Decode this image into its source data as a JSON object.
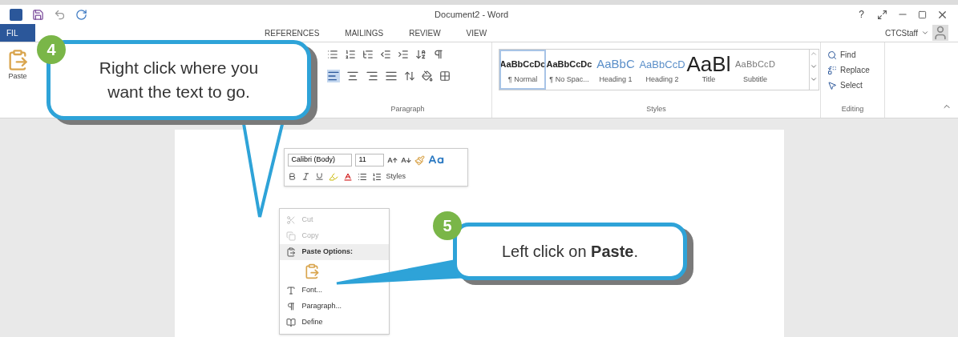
{
  "window": {
    "title": "Document2 - Word",
    "help": "?",
    "user": "CTCStaff"
  },
  "ribbon_tabs": [
    {
      "label": "FIL",
      "selected": true
    },
    {
      "label": "REFERENCES",
      "selected": false
    },
    {
      "label": "MAILINGS",
      "selected": false
    },
    {
      "label": "REVIEW",
      "selected": false
    },
    {
      "label": "VIEW",
      "selected": false
    }
  ],
  "clipboard": {
    "paste": "Paste"
  },
  "paragraph": {
    "label": "Paragraph",
    "align_buttons": [
      {
        "selected": true
      },
      {
        "selected": false
      },
      {
        "selected": false
      },
      {
        "selected": false
      }
    ]
  },
  "styles": {
    "label": "Styles",
    "items": [
      {
        "preview": "AaBbCcDc",
        "name": "¶ Normal",
        "kind": "normal",
        "selected": true
      },
      {
        "preview": "AaBbCcDc",
        "name": "¶ No Spac...",
        "kind": "nospacing",
        "selected": false
      },
      {
        "preview": "AaBbC",
        "name": "Heading 1",
        "kind": "heading1",
        "selected": false
      },
      {
        "preview": "AaBbCcD",
        "name": "Heading 2",
        "kind": "heading2",
        "selected": false
      },
      {
        "preview": "AaBl",
        "name": "Title",
        "kind": "title",
        "selected": false
      },
      {
        "preview": "AaBbCcD",
        "name": "Subtitle",
        "kind": "subtitle",
        "selected": false
      }
    ]
  },
  "editing": {
    "label": "Editing",
    "items": [
      {
        "label": "Find",
        "kind": "find"
      },
      {
        "label": "Replace",
        "kind": "replace"
      },
      {
        "label": "Select",
        "kind": "select"
      }
    ]
  },
  "mini_toolbar": {
    "font": "Calibri (Body)",
    "size": "11",
    "styles": "Styles"
  },
  "context_menu": [
    {
      "label": "Cut",
      "kind": "cut",
      "disabled": true
    },
    {
      "label": "Copy",
      "kind": "copy",
      "disabled": true
    },
    {
      "label": "Paste Options:",
      "kind": "heading",
      "disabled": false
    },
    {
      "kind": "paste-option",
      "disabled": false
    },
    {
      "label": "Font...",
      "kind": "font",
      "disabled": false
    },
    {
      "label": "Paragraph...",
      "kind": "paragraph",
      "disabled": false
    },
    {
      "label": "Define",
      "kind": "define",
      "disabled": false
    }
  ],
  "callouts": [
    {
      "step": "4",
      "text": "Right click where you want the text to go."
    },
    {
      "step": "5",
      "text": "Left click on **Paste**."
    }
  ]
}
